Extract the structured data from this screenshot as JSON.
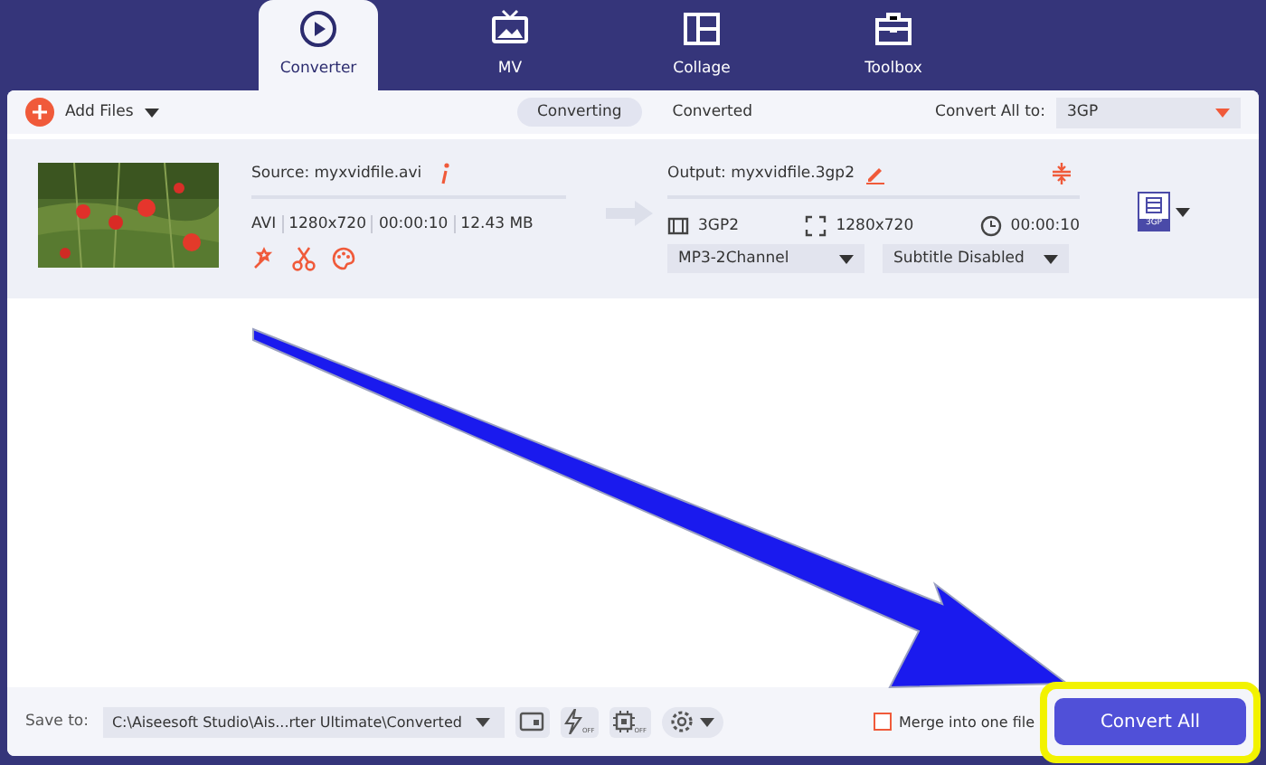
{
  "tabs": [
    {
      "label": "Converter",
      "kind": "converter",
      "selected": true
    },
    {
      "label": "MV",
      "kind": "mv",
      "selected": false
    },
    {
      "label": "Collage",
      "kind": "collage",
      "selected": false
    },
    {
      "label": "Toolbox",
      "kind": "toolbox",
      "selected": false
    }
  ],
  "toolbar": {
    "add_files": "Add Files",
    "views": [
      {
        "label": "Converting",
        "selected": true
      },
      {
        "label": "Converted",
        "selected": false
      }
    ],
    "convert_all_label": "Convert All to:",
    "convert_all_value": "3GP"
  },
  "file": {
    "source": "Source: myxvidfile.avi",
    "info": [
      "AVI",
      "1280x720",
      "00:00:10",
      "12.43 MB"
    ],
    "output": "Output: myxvidfile.3gp2",
    "out_format": "3GP2",
    "out_resolution": "1280x720",
    "out_duration": "00:00:10",
    "audio": "MP3-2Channel",
    "subtitle": "Subtitle Disabled",
    "format_badge": "3GP"
  },
  "bottom": {
    "save_label": "Save to:",
    "path": "C:\\Aiseesoft Studio\\Ais...rter Ultimate\\Converted",
    "accel_badge": "OFF",
    "gpu_badge": "OFF",
    "merge": {
      "label": "Merge into one file",
      "checked": false
    },
    "convert_button": "Convert All"
  }
}
